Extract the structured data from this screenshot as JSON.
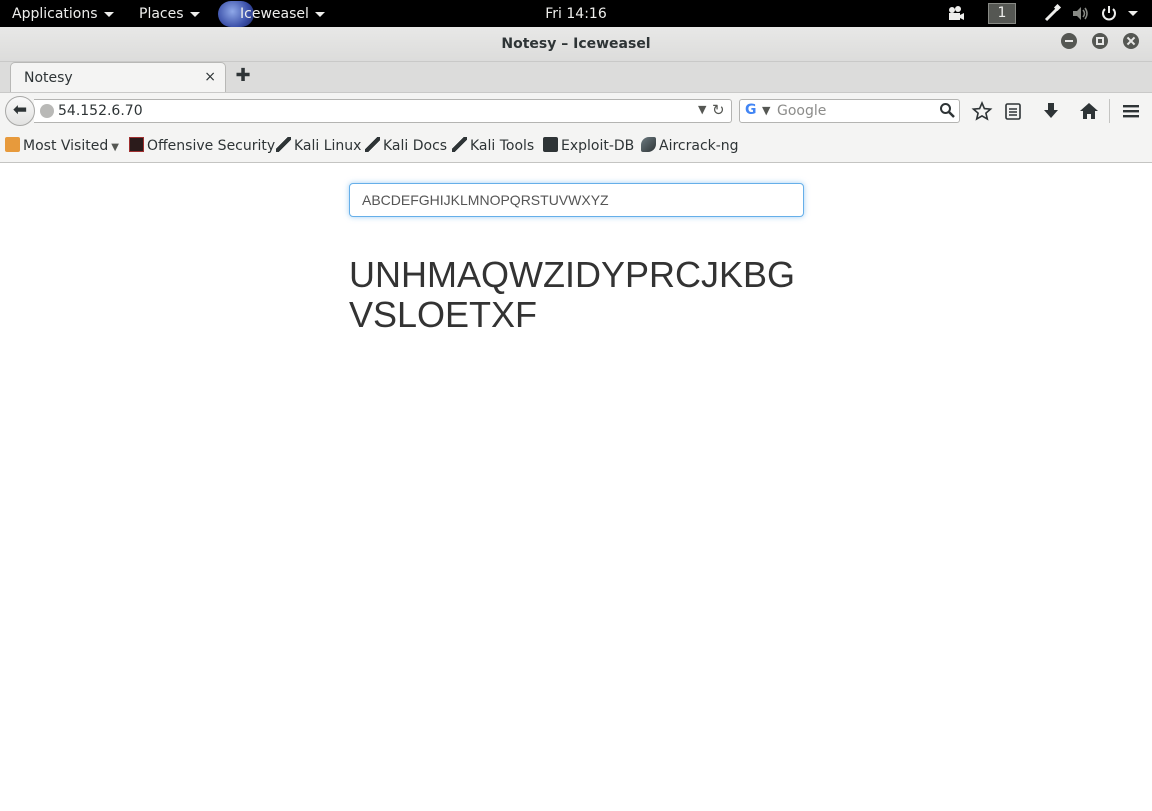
{
  "topbar": {
    "applications": "Applications",
    "places": "Places",
    "app_name": "Iceweasel",
    "clock": "Fri 14:16",
    "workspace": "1"
  },
  "window": {
    "title": "Notesy – Iceweasel"
  },
  "tabs": [
    {
      "label": "Notesy",
      "close": "×"
    }
  ],
  "newtab": "✚",
  "navbar": {
    "back": "⬅",
    "url": "54.152.6.70",
    "url_dropdown": "▼",
    "reload": "↻",
    "search_engine": "G",
    "search_dropdown": "▼",
    "search_placeholder": "Google",
    "search_icon": "⚲"
  },
  "bookmarks": [
    {
      "label": "Most Visited",
      "icon": "folder-icon",
      "dropdown": "▼"
    },
    {
      "label": "Offensive Security",
      "icon": "offsec-icon"
    },
    {
      "label": "Kali Linux",
      "icon": "kali-dragon-icon"
    },
    {
      "label": "Kali Docs",
      "icon": "kali-dragon-icon"
    },
    {
      "label": "Kali Tools",
      "icon": "kali-dragon-icon"
    },
    {
      "label": "Exploit-DB",
      "icon": "exploitdb-icon"
    },
    {
      "label": "Aircrack-ng",
      "icon": "aircrack-icon"
    }
  ],
  "page": {
    "input_value": "ABCDEFGHIJKLMNOPQRSTUVWXYZ",
    "output_text": "UNHMAQWZIDYPRCJKBGVSLOETXF"
  },
  "colors": {
    "topbar_bg": "#000000",
    "input_focus": "#66afe9",
    "output_text": "#333333"
  }
}
